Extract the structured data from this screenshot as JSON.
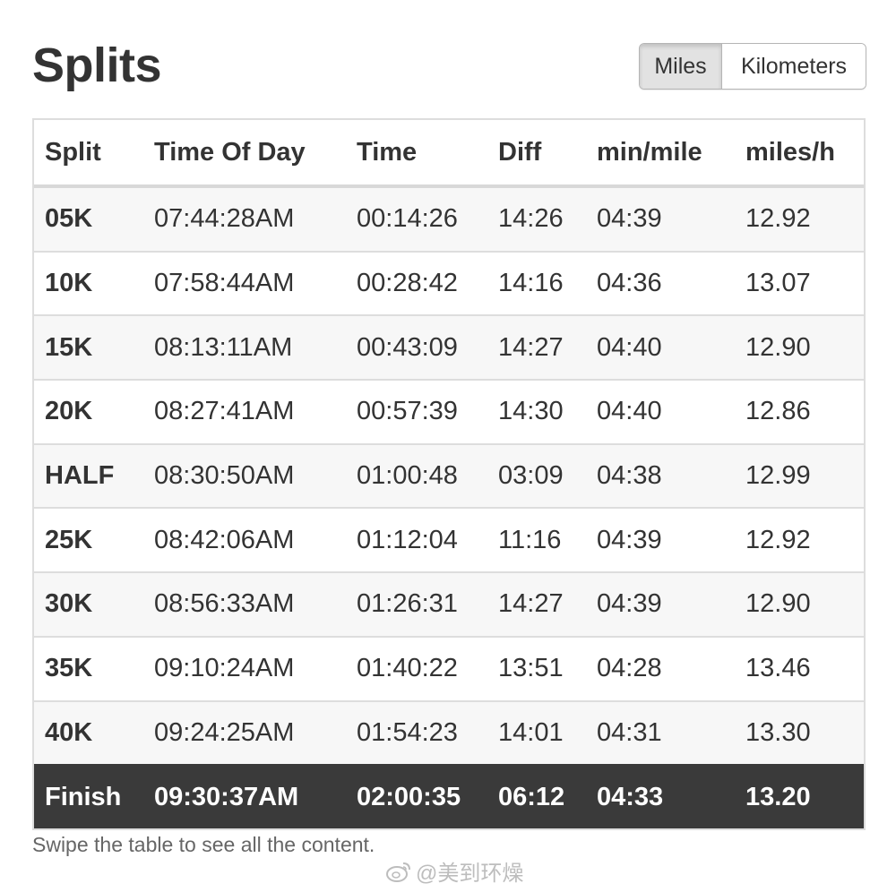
{
  "page": {
    "title": "Splits"
  },
  "unit_toggle": {
    "options": [
      "Miles",
      "Kilometers"
    ],
    "selected": "Miles"
  },
  "table": {
    "headers": [
      "Split",
      "Time Of Day",
      "Time",
      "Diff",
      "min/mile",
      "miles/h"
    ],
    "rows": [
      [
        "05K",
        "07:44:28AM",
        "00:14:26",
        "14:26",
        "04:39",
        "12.92"
      ],
      [
        "10K",
        "07:58:44AM",
        "00:28:42",
        "14:16",
        "04:36",
        "13.07"
      ],
      [
        "15K",
        "08:13:11AM",
        "00:43:09",
        "14:27",
        "04:40",
        "12.90"
      ],
      [
        "20K",
        "08:27:41AM",
        "00:57:39",
        "14:30",
        "04:40",
        "12.86"
      ],
      [
        "HALF",
        "08:30:50AM",
        "01:00:48",
        "03:09",
        "04:38",
        "12.99"
      ],
      [
        "25K",
        "08:42:06AM",
        "01:12:04",
        "11:16",
        "04:39",
        "12.92"
      ],
      [
        "30K",
        "08:56:33AM",
        "01:26:31",
        "14:27",
        "04:39",
        "12.90"
      ],
      [
        "35K",
        "09:10:24AM",
        "01:40:22",
        "13:51",
        "04:28",
        "13.46"
      ],
      [
        "40K",
        "09:24:25AM",
        "01:54:23",
        "14:01",
        "04:31",
        "13.30"
      ],
      [
        "Finish",
        "09:30:37AM",
        "02:00:35",
        "06:12",
        "04:33",
        "13.20"
      ]
    ],
    "highlighted_row": "Finish"
  },
  "footer": {
    "hint": "Swipe the table to see all the content."
  },
  "watermark": {
    "text": "@美到环燥",
    "icon": "weibo-logo-icon"
  },
  "colors": {
    "finish_row_bg": "#3a3a3a",
    "finish_row_text": "#ffffff",
    "selected_toggle_bg": "#e2e2e2",
    "stripe_bg": "#f7f7f7"
  }
}
